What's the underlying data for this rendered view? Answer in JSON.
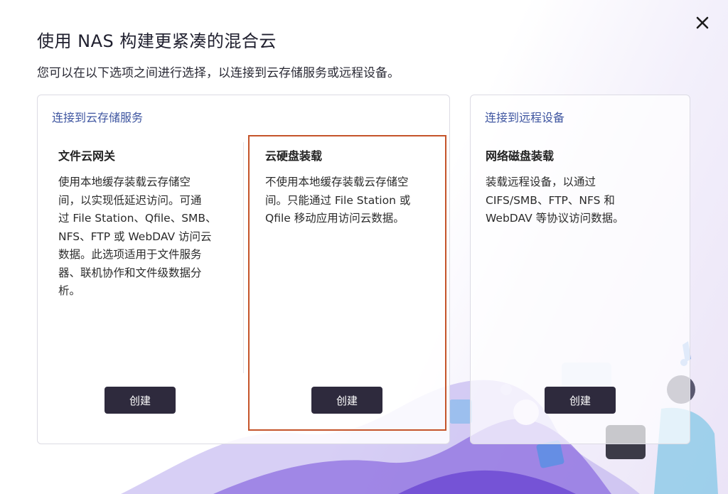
{
  "dialog": {
    "title": "使用 NAS 构建更紧凑的混合云",
    "subtitle": "您可以在以下选项之间进行选择，以连接到云存储服务或远程设备。",
    "close_icon": "close-icon"
  },
  "cloud_panel": {
    "heading": "连接到云存储服务",
    "cards": [
      {
        "title": "文件云网关",
        "lines": [
          "使用本地缓存装载云存储空",
          "间，以实现低延迟访问。可通",
          "过 File Station、Qfile、SMB、",
          "NFS、FTP 或 WebDAV 访问云",
          "数据。此选项适用于文件服务",
          "器、联机协作和文件级数据分",
          "析。"
        ],
        "button": "创建"
      },
      {
        "title": "云硬盘装载",
        "lines": [
          "不使用本地缓存装载云存储空",
          "间。只能通过 File Station 或",
          "Qfile 移动应用访问云数据。"
        ],
        "button": "创建"
      }
    ]
  },
  "remote_panel": {
    "heading": "连接到远程设备",
    "card": {
      "title": "网络磁盘装载",
      "lines": [
        "装载远程设备，以通过",
        "CIFS/SMB、FTP、NFS 和",
        "WebDAV 等协议访问数据。"
      ],
      "button": "创建"
    }
  },
  "colors": {
    "accent_heading": "#3e55a0",
    "button_bg": "#2e2a3d",
    "highlight_border": "#c5542a"
  }
}
